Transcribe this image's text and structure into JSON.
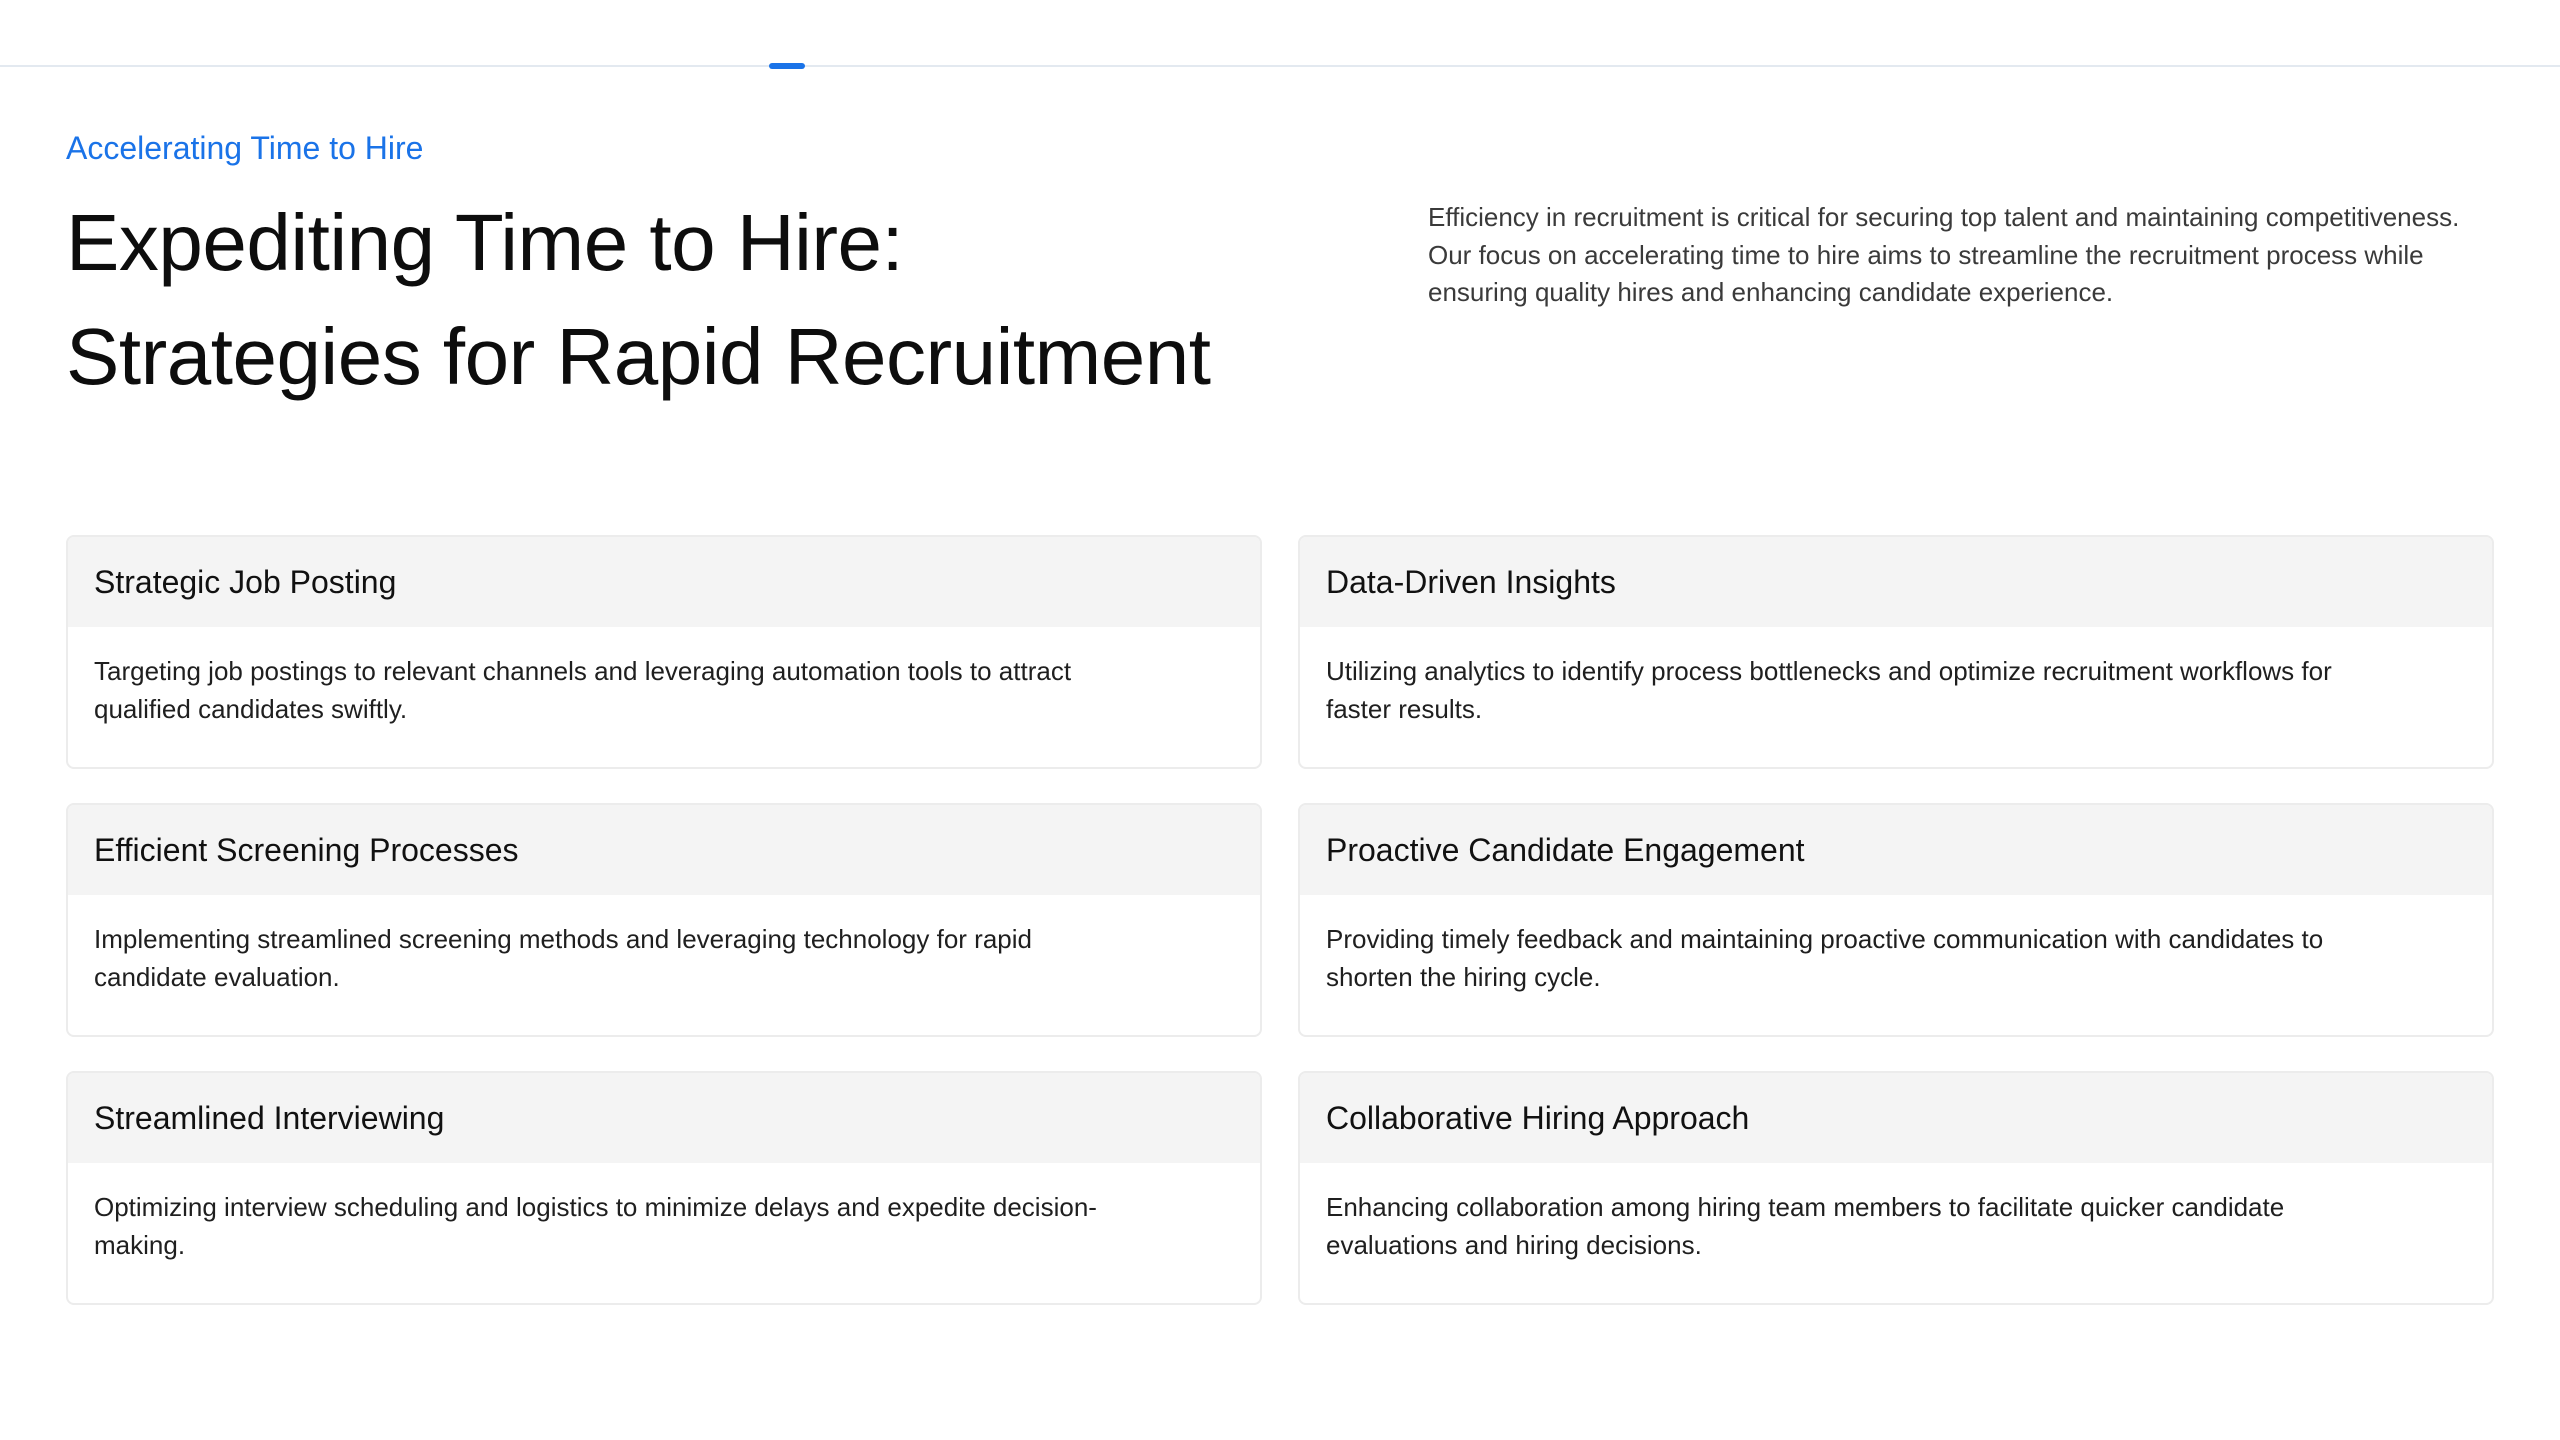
{
  "eyebrow": "Accelerating Time to Hire",
  "headline": {
    "line1": "Expediting Time to Hire:",
    "line2": "Strategies for Rapid Recruitment"
  },
  "intro": "Efficiency in recruitment is critical for securing top talent and maintaining competitiveness. Our focus on accelerating time to hire aims to streamline the recruitment process while ensuring quality hires and enhancing candidate experience.",
  "cards": [
    {
      "title": "Strategic Job Posting",
      "body": "Targeting job postings to relevant channels and leveraging automation tools to attract qualified candidates swiftly."
    },
    {
      "title": "Data-Driven Insights",
      "body": "Utilizing analytics to identify process bottlenecks and optimize recruitment workflows for faster results."
    },
    {
      "title": "Efficient Screening Processes",
      "body": "Implementing streamlined screening methods and leveraging technology for rapid candidate evaluation."
    },
    {
      "title": "Proactive Candidate Engagement",
      "body": "Providing timely feedback and maintaining proactive communication with candidates to shorten the hiring cycle."
    },
    {
      "title": "Streamlined Interviewing",
      "body": "Optimizing interview scheduling and logistics to minimize delays and expedite decision-making."
    },
    {
      "title": "Collaborative Hiring Approach",
      "body": "Enhancing collaboration among hiring team members to facilitate quicker candidate evaluations and hiring decisions."
    }
  ],
  "colors": {
    "accent": "#1a73e8",
    "card_header": "#f4f4f4",
    "card_border": "#ececec"
  }
}
